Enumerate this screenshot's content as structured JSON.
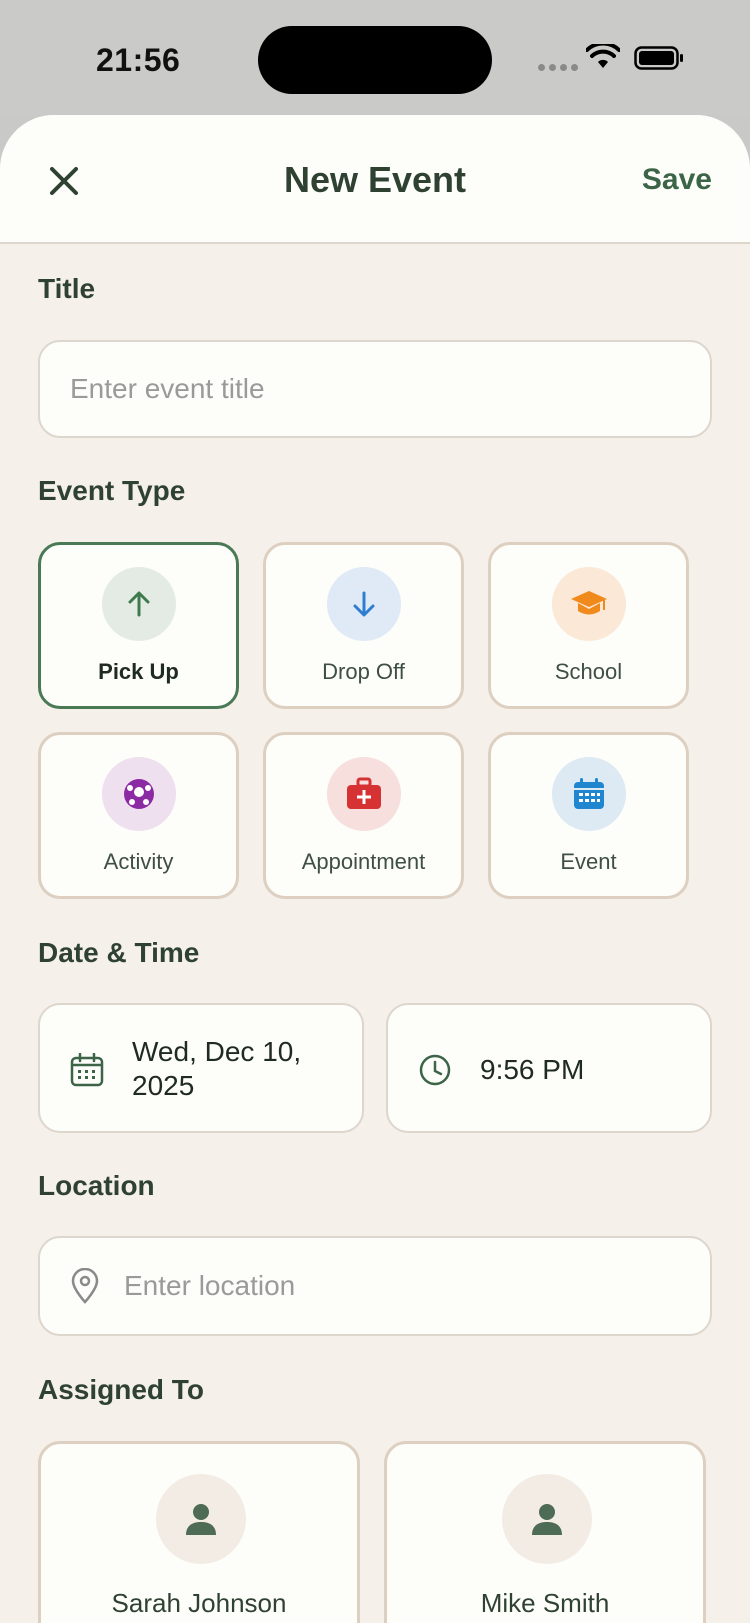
{
  "status": {
    "time": "21:56"
  },
  "nav": {
    "title": "New Event",
    "save_label": "Save"
  },
  "title_section": {
    "label": "Title",
    "placeholder": "Enter event title"
  },
  "event_type": {
    "label": "Event Type",
    "options": [
      {
        "label": "Pick Up",
        "icon": "arrow-up-icon",
        "color": "#3f7a4f",
        "bg": "#e4ebe4",
        "selected": true
      },
      {
        "label": "Drop Off",
        "icon": "arrow-down-icon",
        "color": "#2f7dd1",
        "bg": "#dfeaf6",
        "selected": false
      },
      {
        "label": "School",
        "icon": "graduation-cap-icon",
        "color": "#f08a1c",
        "bg": "#fbe8d6",
        "selected": false
      },
      {
        "label": "Activity",
        "icon": "soccer-ball-icon",
        "color": "#8c2aa3",
        "bg": "#eee0ee",
        "selected": false
      },
      {
        "label": "Appointment",
        "icon": "medical-kit-icon",
        "color": "#d63234",
        "bg": "#f6dfdc",
        "selected": false
      },
      {
        "label": "Event",
        "icon": "calendar-icon",
        "color": "#1f86cf",
        "bg": "#dde9f3",
        "selected": false
      }
    ]
  },
  "date_time": {
    "label": "Date & Time",
    "date": "Wed, Dec 10, 2025",
    "time": "9:56 PM"
  },
  "location": {
    "label": "Location",
    "placeholder": "Enter location"
  },
  "assigned": {
    "label": "Assigned To",
    "people": [
      {
        "name": "Sarah Johnson"
      },
      {
        "name": "Mike Smith"
      }
    ]
  },
  "colors": {
    "accent": "#3c6447",
    "background": "#f5f0ea",
    "card": "#fdfdfa",
    "border": "#ddd0c0"
  }
}
